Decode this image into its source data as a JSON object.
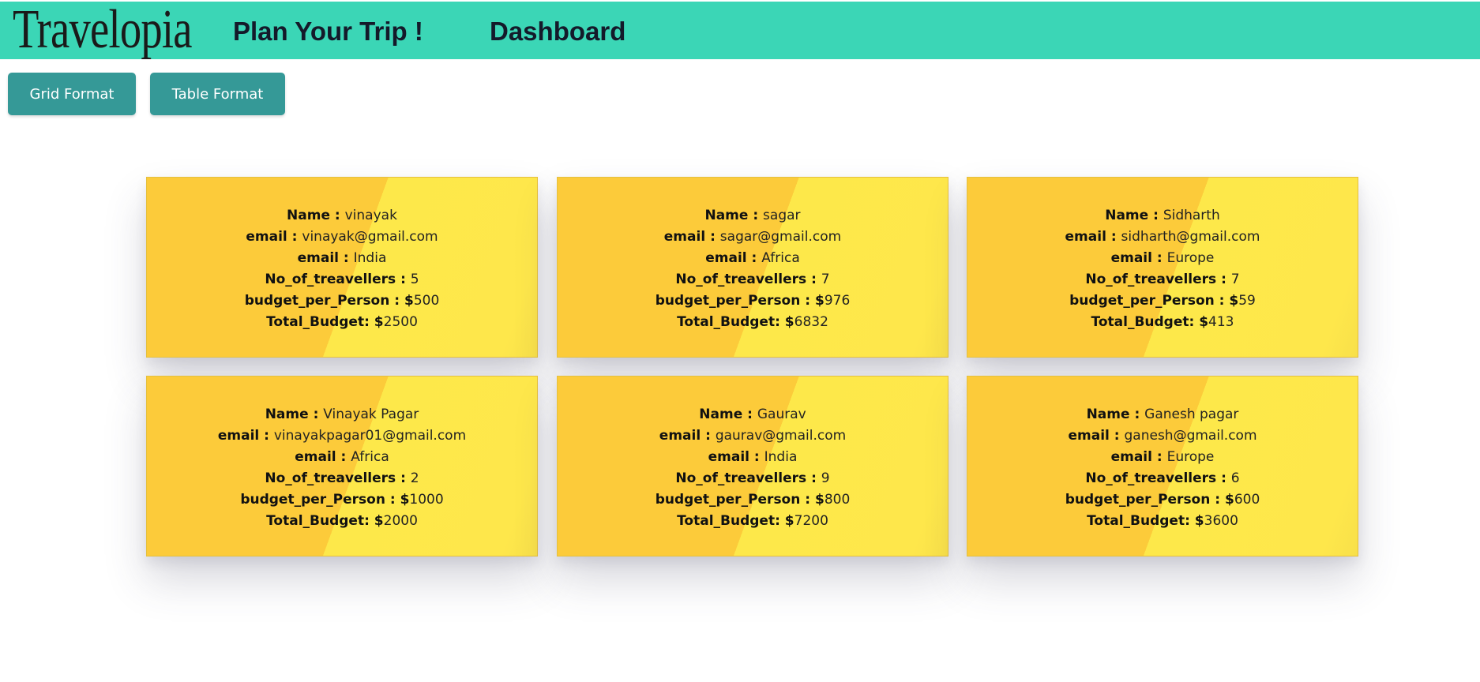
{
  "header": {
    "logo": "Travelopia",
    "nav": {
      "plan_trip": "Plan Your Trip !",
      "dashboard": "Dashboard"
    }
  },
  "view_toggle": {
    "grid_label": "Grid Format",
    "table_label": "Table Format"
  },
  "labels": {
    "name": "Name : ",
    "email": "email : ",
    "destination": "email : ",
    "travellers": "No_of_treavellers : ",
    "budget_per_person": "budget_per_Person : $",
    "total_budget": "Total_Budget: $"
  },
  "trips": [
    {
      "name": "vinayak",
      "email": "vinayak@gmail.com",
      "destination": "India",
      "travellers": "5",
      "budget_per_person": "500",
      "total_budget": "2500"
    },
    {
      "name": "sagar",
      "email": "sagar@gmail.com",
      "destination": "Africa",
      "travellers": "7",
      "budget_per_person": "976",
      "total_budget": "6832"
    },
    {
      "name": "Sidharth",
      "email": "sidharth@gmail.com",
      "destination": "Europe",
      "travellers": "7",
      "budget_per_person": "59",
      "total_budget": "413"
    },
    {
      "name": "Vinayak Pagar",
      "email": "vinayakpagar01@gmail.com",
      "destination": "Africa",
      "travellers": "2",
      "budget_per_person": "1000",
      "total_budget": "2000"
    },
    {
      "name": "Gaurav",
      "email": "gaurav@gmail.com",
      "destination": "India",
      "travellers": "9",
      "budget_per_person": "800",
      "total_budget": "7200"
    },
    {
      "name": "Ganesh pagar",
      "email": "ganesh@gmail.com",
      "destination": "Europe",
      "travellers": "6",
      "budget_per_person": "600",
      "total_budget": "3600"
    }
  ],
  "colors": {
    "navbar": "#3bd6b6",
    "button": "#359997",
    "card_dark": "#fccb3a",
    "card_light": "#fde84a"
  }
}
